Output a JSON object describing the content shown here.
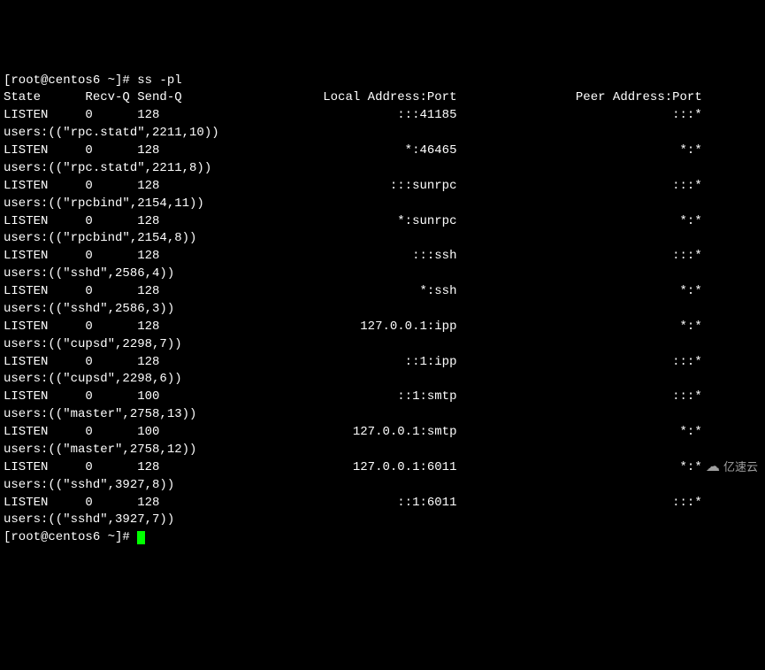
{
  "prompt": "[root@centos6 ~]# ",
  "command": "ss -pl",
  "headers": {
    "state": "State",
    "recvq": "Recv-Q",
    "sendq": "Send-Q",
    "local": "Local Address:Port",
    "peer": "Peer Address:Port"
  },
  "rows": [
    {
      "state": "LISTEN",
      "recvq": "0",
      "sendq": "128",
      "local": ":::41185",
      "peer": ":::*",
      "users": "users:((\"rpc.statd\",2211,10))"
    },
    {
      "state": "LISTEN",
      "recvq": "0",
      "sendq": "128",
      "local": "*:46465",
      "peer": "*:*",
      "users": "users:((\"rpc.statd\",2211,8))"
    },
    {
      "state": "LISTEN",
      "recvq": "0",
      "sendq": "128",
      "local": ":::sunrpc",
      "peer": ":::*",
      "users": "users:((\"rpcbind\",2154,11))"
    },
    {
      "state": "LISTEN",
      "recvq": "0",
      "sendq": "128",
      "local": "*:sunrpc",
      "peer": "*:*",
      "users": "users:((\"rpcbind\",2154,8))"
    },
    {
      "state": "LISTEN",
      "recvq": "0",
      "sendq": "128",
      "local": ":::ssh",
      "peer": ":::*",
      "users": "users:((\"sshd\",2586,4))"
    },
    {
      "state": "LISTEN",
      "recvq": "0",
      "sendq": "128",
      "local": "*:ssh",
      "peer": "*:*",
      "users": "users:((\"sshd\",2586,3))"
    },
    {
      "state": "LISTEN",
      "recvq": "0",
      "sendq": "128",
      "local": "127.0.0.1:ipp",
      "peer": "*:*",
      "users": "users:((\"cupsd\",2298,7))"
    },
    {
      "state": "LISTEN",
      "recvq": "0",
      "sendq": "128",
      "local": "::1:ipp",
      "peer": ":::*",
      "users": "users:((\"cupsd\",2298,6))"
    },
    {
      "state": "LISTEN",
      "recvq": "0",
      "sendq": "100",
      "local": "::1:smtp",
      "peer": ":::*",
      "users": "users:((\"master\",2758,13))"
    },
    {
      "state": "LISTEN",
      "recvq": "0",
      "sendq": "100",
      "local": "127.0.0.1:smtp",
      "peer": "*:*",
      "users": "users:((\"master\",2758,12))"
    },
    {
      "state": "LISTEN",
      "recvq": "0",
      "sendq": "128",
      "local": "127.0.0.1:6011",
      "peer": "*:*",
      "users": "users:((\"sshd\",3927,8))"
    },
    {
      "state": "LISTEN",
      "recvq": "0",
      "sendq": "128",
      "local": "::1:6011",
      "peer": ":::*",
      "users": "users:((\"sshd\",3927,7))"
    }
  ],
  "prompt_end": "[root@centos6 ~]# ",
  "watermark": "亿速云",
  "columns": {
    "state_w": 11,
    "recvq_w": 7,
    "sendq_w": 7,
    "local_w": 36,
    "peer_w": 33
  }
}
